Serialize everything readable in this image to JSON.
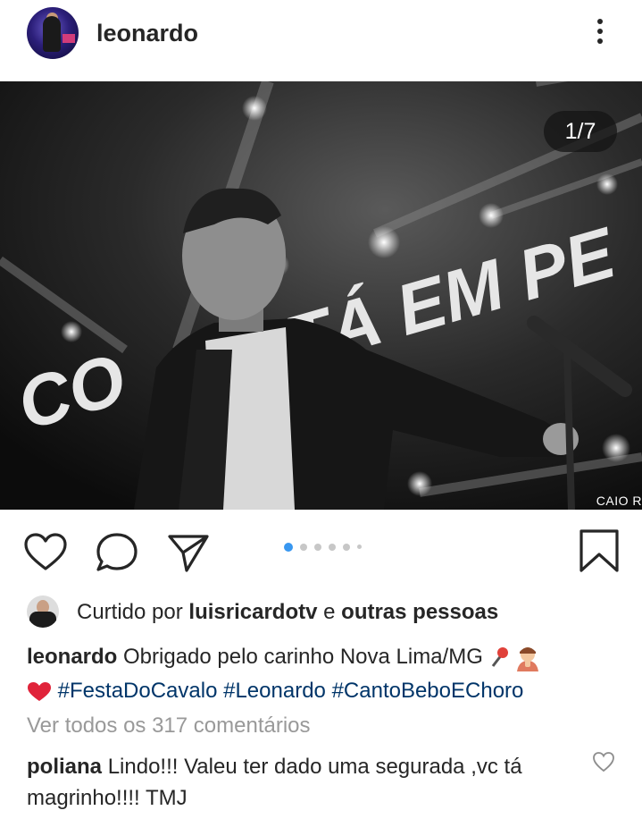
{
  "post": {
    "author": "leonardo",
    "image_counter": "1/7",
    "photo_credit": "CAIO R",
    "photo_text": "CO      TÁ EM PE",
    "carousel_total": 6,
    "carousel_active": 1
  },
  "likes": {
    "prefix": "Curtido por",
    "user": "luisricardotv",
    "connector": "e",
    "others": "outras pessoas"
  },
  "caption": {
    "author": "leonardo",
    "text": "Obrigado pelo carinho Nova Lima/MG",
    "hashtags": [
      "#FestaDoCavalo",
      "#Leonardo",
      "#CantoBeboEChoro"
    ]
  },
  "view_all_comments": "Ver todos os 317 comentários",
  "comments": [
    {
      "user": "poliana",
      "text": "Lindo!!! Valeu ter  dado uma segurada ,vc tá magrinho!!!! TMJ"
    }
  ],
  "icons": {
    "like": "heart-outline-icon",
    "comment": "speech-bubble-icon",
    "share": "paper-plane-icon",
    "save": "bookmark-icon",
    "more": "vertical-dots-icon"
  },
  "colors": {
    "hashtag": "#003569",
    "carousel_active": "#3897f0",
    "muted": "#999999"
  }
}
